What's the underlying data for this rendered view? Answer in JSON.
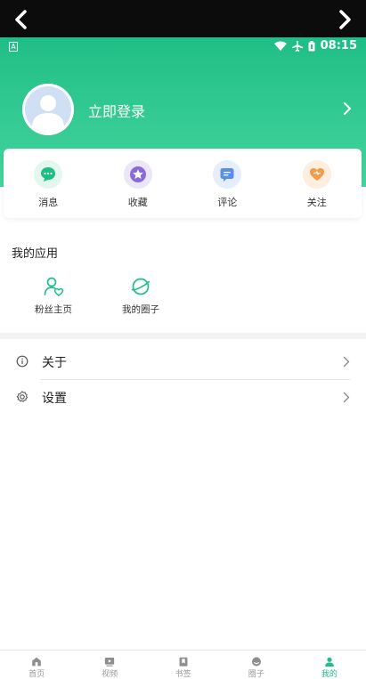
{
  "statusbar": {
    "time": "08:15",
    "app_badge": "A"
  },
  "profile": {
    "login_label": "立即登录"
  },
  "quick_actions": [
    {
      "label": "消息",
      "icon": "chat-bubble-icon",
      "color": "#1fbe86",
      "bg": "#e3f7ef"
    },
    {
      "label": "收藏",
      "icon": "star-icon",
      "color": "#8a6ad8",
      "bg": "#ece6fa"
    },
    {
      "label": "评论",
      "icon": "comment-icon",
      "color": "#5b8ee8",
      "bg": "#e6eefb"
    },
    {
      "label": "关注",
      "icon": "heart-icon",
      "color": "#f59a4a",
      "bg": "#fdeedf"
    }
  ],
  "apps": {
    "title": "我的应用",
    "items": [
      {
        "label": "粉丝主页",
        "icon": "user-heart-icon"
      },
      {
        "label": "我的圈子",
        "icon": "planet-icon"
      }
    ]
  },
  "menu": [
    {
      "label": "关于",
      "icon": "info-icon"
    },
    {
      "label": "设置",
      "icon": "gear-icon"
    }
  ],
  "tabs": [
    {
      "label": "首页",
      "icon": "home-icon",
      "active": false
    },
    {
      "label": "视频",
      "icon": "video-icon",
      "active": false
    },
    {
      "label": "书签",
      "icon": "bookmark-icon",
      "active": false
    },
    {
      "label": "圈子",
      "icon": "circle-icon",
      "active": false
    },
    {
      "label": "我的",
      "icon": "user-icon",
      "active": true
    }
  ],
  "colors": {
    "accent": "#1fbe86",
    "header_top": "#1fbe86",
    "header_bottom": "#45d49e"
  }
}
